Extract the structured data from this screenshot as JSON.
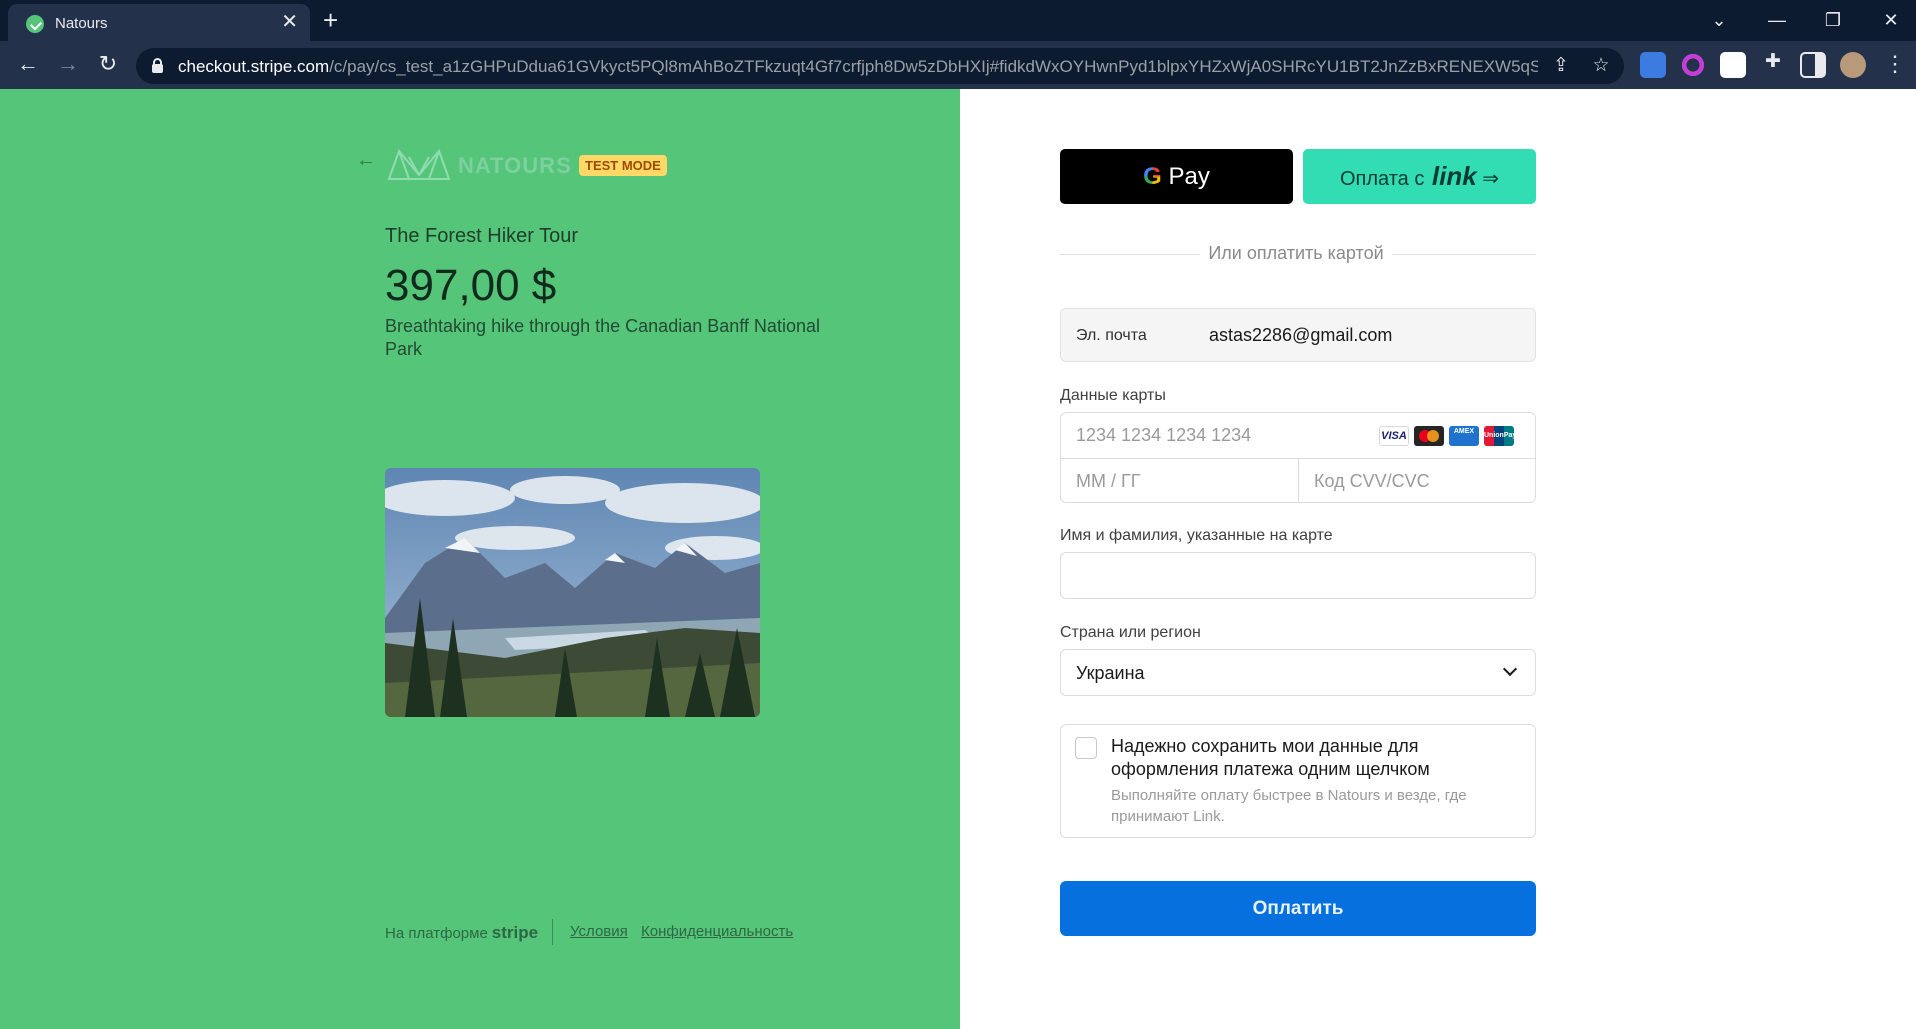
{
  "browser": {
    "tab_title": "Natours",
    "tab_close": "✕",
    "new_tab": "+",
    "url_host": "checkout.stripe.com",
    "url_path": "/c/pay/cs_test_a1zGHPuDdua61GVkyct5PQl8mAhBoZTFkzuqt4Gf7crfjph8Dw5zDbHXIj#fidkdWxOYHwnPyd1blpxYHZxWjA0SHRcYU1BT2JnZzBxRENEXW5qS...",
    "controls": {
      "minimize": "—",
      "restore": "❐",
      "close": "✕",
      "tab_search": "⌄"
    }
  },
  "product": {
    "back_arrow": "←",
    "brand_text": "NATOURS",
    "test_mode": "TEST MODE",
    "name": "The Forest Hiker Tour",
    "price": "397,00 $",
    "description": "Breathtaking hike through the Canadian Banff National Park"
  },
  "footer": {
    "powered_by": "На платформе",
    "stripe": "stripe",
    "terms": "Условия",
    "privacy": "Конфиденциальность"
  },
  "form": {
    "gpay_g": "G",
    "gpay_label": "Pay",
    "link_prefix": "Оплата с",
    "link_logo": "link",
    "link_arrow": "⇒",
    "divider": "Или оплатить картой",
    "email_key": "Эл. почта",
    "email_value": "astas2286@gmail.com",
    "card_label": "Данные карты",
    "card_number_placeholder": "1234 1234 1234 1234",
    "expiry_placeholder": "ММ / ГГ",
    "cvc_placeholder": "Код CVV/CVC",
    "brands": {
      "visa": "VISA",
      "amex": "AMEX",
      "unionpay": "UnionPay"
    },
    "name_label": "Имя и фамилия, указанные на карте",
    "country_label": "Страна или регион",
    "country_value": "Украина",
    "save_title": "Надежно сохранить мои данные для оформления платежа одним щелчком",
    "save_desc": "Выполняйте оплату быстрее в Natours и везде, где принимают Link.",
    "pay_button": "Оплатить"
  },
  "colors": {
    "left_panel": "#55c57a",
    "pay_button": "#0570de",
    "link_button": "#33ddb3",
    "test_badge": "#ffd866"
  }
}
